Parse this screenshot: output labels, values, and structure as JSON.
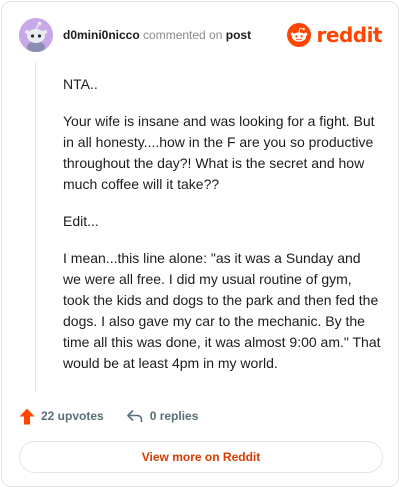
{
  "header": {
    "username": "d0mini0nicco",
    "commented_on": "commented on",
    "post_link": "post",
    "brand": "reddit"
  },
  "comment": {
    "paragraphs": [
      "NTA..",
      "Your wife is insane and was looking for a fight. But in all honesty....how in the F are you so productive throughout the day?! What is the secret and how much coffee will it take??",
      "Edit...",
      "I mean...this line alone: \"as it was a Sunday and we were all free. I did my usual routine of gym, took the kids and dogs to the park and then fed the dogs. I also gave my car to the mechanic. By the time all this was done, it was almost 9:00 am.\" That would be at least 4pm in my world."
    ]
  },
  "actions": {
    "upvotes": "22 upvotes",
    "replies": "0 replies"
  },
  "footer": {
    "view_more": "View more on Reddit"
  },
  "colors": {
    "brand": "#ff4500",
    "upvote": "#ff4500",
    "link": "#d93a00",
    "avatar_bg": "#c9a8e8"
  },
  "icons": {
    "avatar": "snoo-avatar",
    "brand": "reddit-logo-icon",
    "upvote": "upvote-arrow-icon",
    "reply": "reply-arrow-icon"
  }
}
